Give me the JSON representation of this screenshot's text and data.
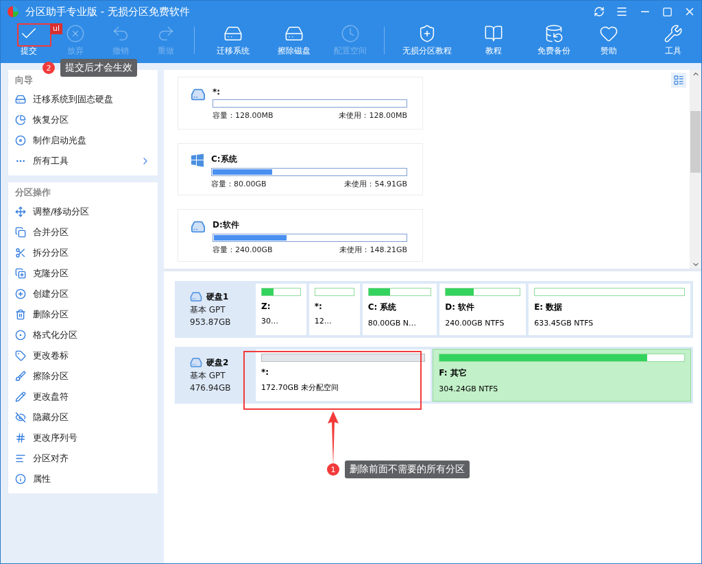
{
  "window": {
    "title": "分区助手专业版 - 无损分区免费软件"
  },
  "toolbar": [
    {
      "label": "提交",
      "disabled": false
    },
    {
      "label": "放弃",
      "disabled": true
    },
    {
      "label": "撤销",
      "disabled": true
    },
    {
      "label": "重做",
      "disabled": true
    },
    {
      "label": "迁移系统",
      "disabled": false
    },
    {
      "label": "擦除磁盘",
      "disabled": false
    },
    {
      "label": "配置空间",
      "disabled": true
    },
    {
      "label": "无损分区教程",
      "disabled": false
    },
    {
      "label": "教程",
      "disabled": false
    },
    {
      "label": "免费备份",
      "disabled": false
    },
    {
      "label": "赞助",
      "disabled": false
    },
    {
      "label": "工具",
      "disabled": false
    }
  ],
  "toolbar_badge": "ul",
  "sidebar": [
    {
      "title": "向导",
      "items": [
        {
          "label": "迁移系统到固态硬盘",
          "expandable": false
        },
        {
          "label": "恢复分区",
          "expandable": false
        },
        {
          "label": "制作启动光盘",
          "expandable": false
        },
        {
          "label": "所有工具",
          "expandable": true
        }
      ]
    },
    {
      "title": "分区操作",
      "items": [
        {
          "label": "调整/移动分区",
          "expandable": false
        },
        {
          "label": "合并分区",
          "expandable": false
        },
        {
          "label": "拆分分区",
          "expandable": false
        },
        {
          "label": "克隆分区",
          "expandable": false
        },
        {
          "label": "创建分区",
          "expandable": false
        },
        {
          "label": "删除分区",
          "expandable": false
        },
        {
          "label": "格式化分区",
          "expandable": false
        },
        {
          "label": "更改卷标",
          "expandable": false
        },
        {
          "label": "擦除分区",
          "expandable": false
        },
        {
          "label": "更改盘符",
          "expandable": false
        },
        {
          "label": "隐藏分区",
          "expandable": false
        },
        {
          "label": "更改序列号",
          "expandable": false
        },
        {
          "label": "分区对齐",
          "expandable": false
        },
        {
          "label": "属性",
          "expandable": false
        }
      ]
    }
  ],
  "partition_cards": [
    {
      "kind": "drive",
      "name": "*:",
      "level": 0,
      "capacity": "容量：128.00MB",
      "free": "未使用：128.00MB"
    },
    {
      "kind": "windows",
      "name": "C:系统",
      "level": 0.31,
      "capacity": "容量：80.00GB",
      "free": "未使用：54.91GB"
    },
    {
      "kind": "drive",
      "name": "D:软件",
      "level": 0.38,
      "capacity": "容量：240.00GB",
      "free": "未使用：148.21GB"
    }
  ],
  "disks": [
    {
      "name": "硬盘1",
      "type": "基本 GPT",
      "size": "953.87GB",
      "partitions": [
        {
          "kind": "partition",
          "name": "Z:",
          "info": "30…",
          "level": 0.3,
          "selected": false
        },
        {
          "kind": "partition",
          "name": "*:",
          "info": "12…",
          "selected": false
        },
        {
          "kind": "partition",
          "name": "C: 系统",
          "info": "80.00GB N…",
          "level": 0.35,
          "selected": false
        },
        {
          "kind": "partition",
          "name": "D: 软件",
          "info": "240.00GB NTFS",
          "level": 0.38,
          "selected": false
        },
        {
          "kind": "partition",
          "name": "E: 数据",
          "info": "633.45GB NTFS",
          "selected": false
        }
      ]
    },
    {
      "name": "硬盘2",
      "type": "基本 GPT",
      "size": "476.94GB",
      "partitions": [
        {
          "kind": "unallocated",
          "name": "*:",
          "info": "172.70GB 未分配空间",
          "selected": false
        },
        {
          "kind": "partition",
          "name": "F: 其它",
          "info": "304.24GB NTFS",
          "level": 0.85,
          "selected": true
        }
      ]
    }
  ],
  "annotations": [
    {
      "number": "2",
      "text": "提交后才会生效"
    },
    {
      "number": "1",
      "text": "删除前面不需要的所有分区"
    }
  ]
}
